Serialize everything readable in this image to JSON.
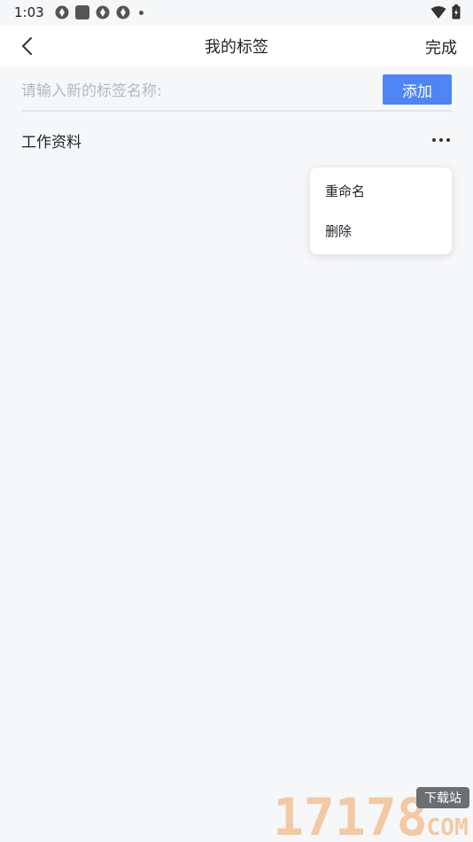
{
  "status_bar": {
    "time": "1:03",
    "icons": [
      "aperture-icon",
      "square-notification-icon",
      "aperture-icon",
      "aperture-icon",
      "dot-icon"
    ],
    "right_icons": [
      "wifi-icon",
      "battery-icon"
    ]
  },
  "header": {
    "title": "我的标签",
    "done_label": "完成",
    "back_icon": "chevron-left-icon"
  },
  "input": {
    "placeholder": "请输入新的标签名称:",
    "value": "",
    "add_label": "添加"
  },
  "tags": [
    {
      "label": "工作资料",
      "more_icon": "more-dots-icon"
    }
  ],
  "popup_menu": {
    "items": [
      "重命名",
      "删除"
    ]
  },
  "watermark": {
    "number": "17178",
    "badge": "下载站",
    "domain": ".COM"
  },
  "colors": {
    "accent": "#4f84f7",
    "background": "#f6f7f9",
    "header_bg": "#ffffff",
    "text": "#1f2329",
    "placeholder": "#b3b8c0",
    "watermark": "#f3c9a3"
  }
}
